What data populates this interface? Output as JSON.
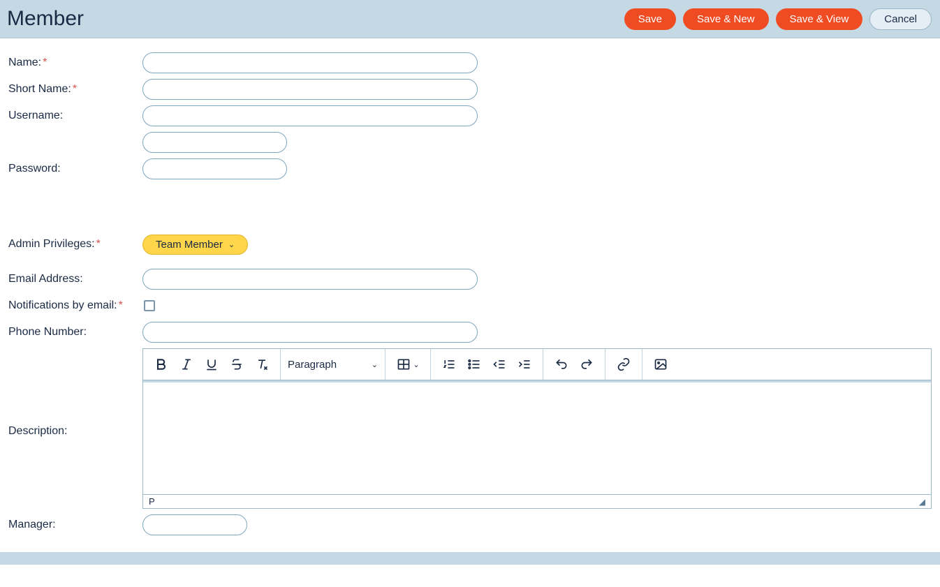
{
  "header": {
    "title": "Member",
    "buttons": {
      "save": "Save",
      "save_new": "Save & New",
      "save_view": "Save & View",
      "cancel": "Cancel"
    }
  },
  "form": {
    "name": {
      "label": "Name:",
      "required": true,
      "value": ""
    },
    "short_name": {
      "label": "Short Name:",
      "required": true,
      "value": ""
    },
    "username": {
      "label": "Username:",
      "required": false,
      "value": ""
    },
    "username_extra": {
      "value": ""
    },
    "password": {
      "label": "Password:",
      "required": false,
      "value": ""
    },
    "admin_priv": {
      "label": "Admin Privileges:",
      "required": true,
      "selected": "Team Member"
    },
    "email": {
      "label": "Email Address:",
      "required": false,
      "value": ""
    },
    "notify": {
      "label": "Notifications by email:",
      "required": true,
      "checked": false
    },
    "phone": {
      "label": "Phone Number:",
      "required": false,
      "value": ""
    },
    "description": {
      "label": "Description:",
      "value": ""
    },
    "manager": {
      "label": "Manager:",
      "value": ""
    }
  },
  "editor": {
    "block_format": "Paragraph",
    "path": "P"
  }
}
